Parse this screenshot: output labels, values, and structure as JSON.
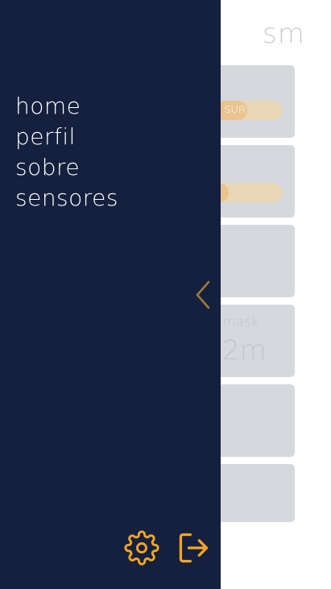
{
  "app": {
    "title": "sm"
  },
  "cards": [
    {
      "pill_text": "SUR",
      "pill_level_percent": 60
    },
    {
      "pill_text": "",
      "pill_level_percent": 40
    },
    {},
    {
      "label": "mask",
      "big_value": "2m"
    },
    {},
    {}
  ],
  "drawer": {
    "menu": [
      {
        "label": "home"
      },
      {
        "label": "perfil"
      },
      {
        "label": "sobre"
      },
      {
        "label": "sensores"
      }
    ],
    "collapse_icon": "chevron-left-icon",
    "settings_icon": "gear-icon",
    "logout_icon": "logout-icon"
  },
  "colors": {
    "drawer_bg": "#15203e",
    "accent": "#f5a623",
    "chevron": "#a07a3a",
    "card_bg": "#d5d8dc",
    "menu_text": "#ffffff"
  }
}
